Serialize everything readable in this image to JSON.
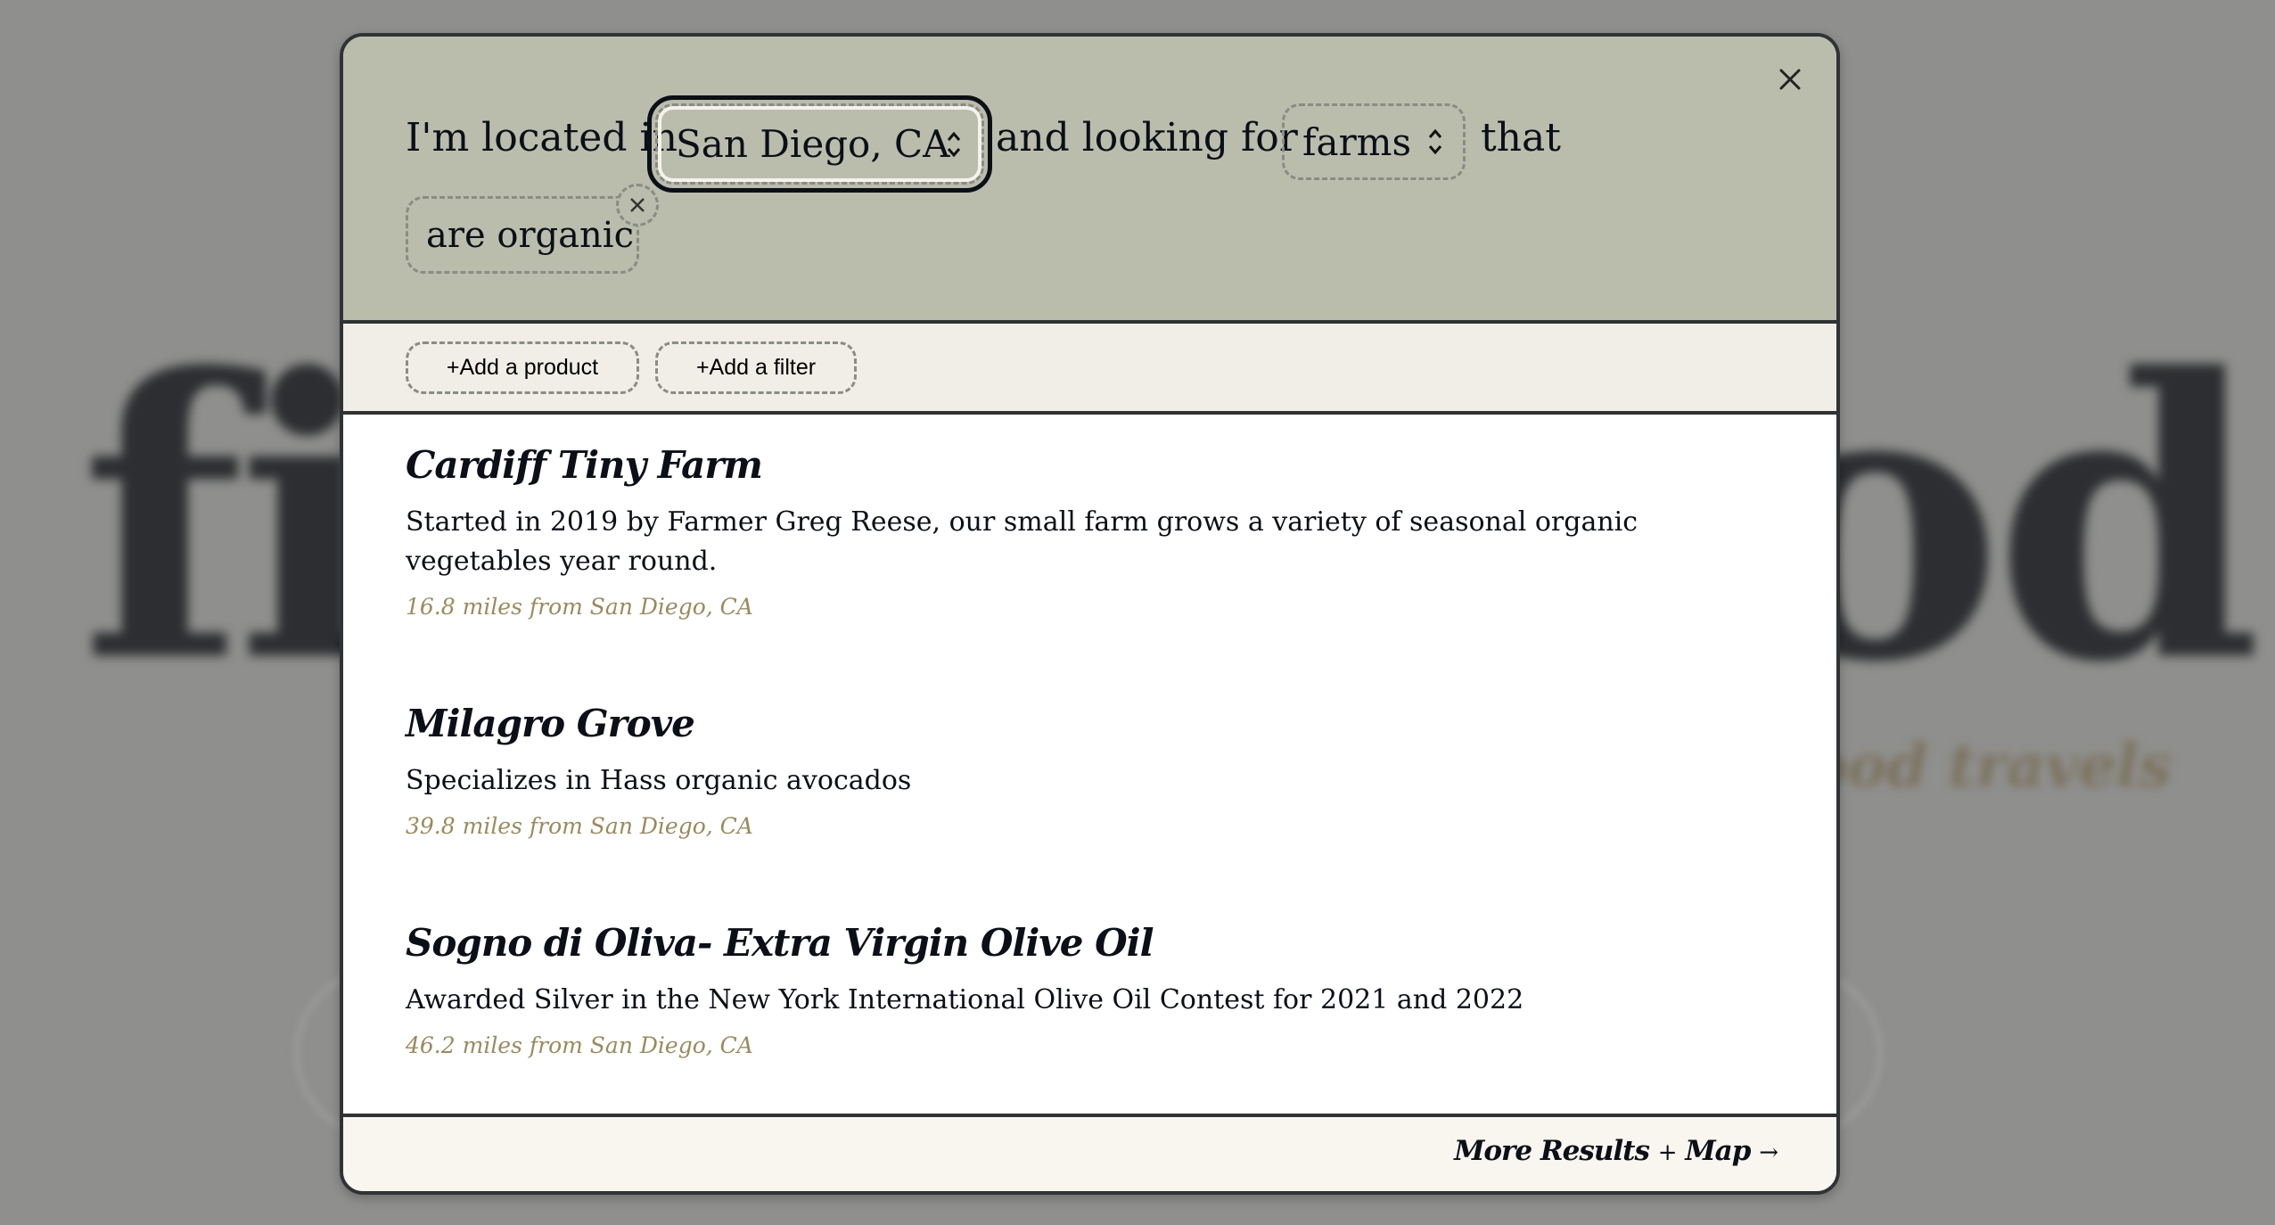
{
  "background": {
    "logo_left": "fi",
    "logo_right": "od",
    "tagline_fragment": "food travels"
  },
  "search": {
    "prefix": "I'm located in",
    "location": "San Diego, CA",
    "middle": "and looking for",
    "category": "farms",
    "suffix": "that",
    "filters": [
      {
        "label": "are organic"
      }
    ],
    "close_icon": "close-icon",
    "chevron_icon": "chevron-up-down-icon"
  },
  "toolbar": {
    "add_product": "+Add a product",
    "add_filter": "+Add a filter"
  },
  "results": [
    {
      "name": "Cardiff Tiny Farm",
      "description": "Started in 2019 by Farmer Greg Reese, our small farm grows a variety of seasonal organic vegetables year round.",
      "distance": "16.8 miles from San Diego, CA"
    },
    {
      "name": "Milagro Grove",
      "description": "Specializes in Hass organic avocados",
      "distance": "39.8 miles from San Diego, CA"
    },
    {
      "name": "Sogno di Oliva- Extra Virgin Olive Oil",
      "description": "Awarded Silver in the New York International Olive Oil Contest for 2021 and 2022",
      "distance": "46.2 miles from San Diego, CA"
    }
  ],
  "footer": {
    "more_part1": "More Results",
    "plus": "+",
    "more_part2": "Map",
    "arrow": "→"
  },
  "colors": {
    "header_bg": "#babdac",
    "toolbar_bg": "#f0eee7",
    "footer_bg": "#f9f5ef",
    "distance": "#9b8a5c",
    "overlay": "#8f8f8d"
  }
}
